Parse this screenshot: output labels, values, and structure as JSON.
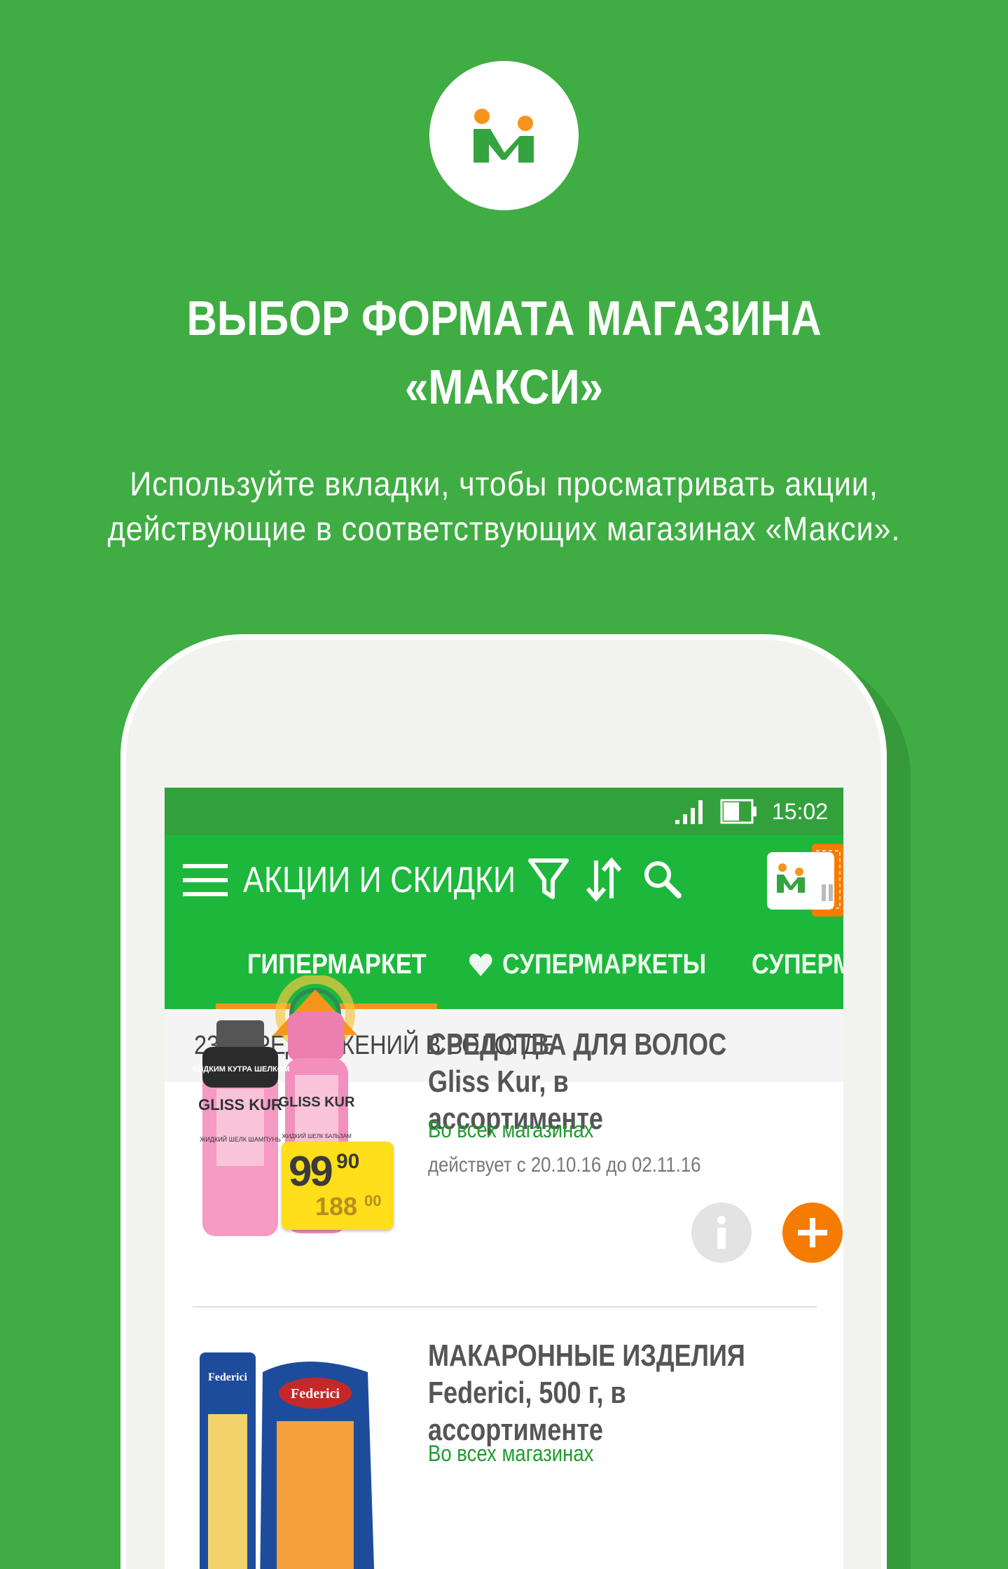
{
  "header": {
    "headline_line1": "ВЫБОР ФОРМАТА МАГАЗИНА",
    "headline_line2": "«МАКСИ»",
    "subline_line1": "Используйте вкладки, чтобы просматривать акции,",
    "subline_line2": "действующие в соответствующих магазинах «Макси»."
  },
  "statusbar": {
    "time": "15:02"
  },
  "toolbar": {
    "title": "АКЦИИ И СКИДКИ",
    "icons": [
      "menu-icon",
      "filter-icon",
      "sort-icon",
      "search-icon",
      "store-logo-icon"
    ]
  },
  "tabs": [
    {
      "label": "ГИПЕРМАРКЕТ",
      "active": true
    },
    {
      "label": "СУПЕРМАРКЕТЫ",
      "active": false,
      "icon": "heart-icon"
    },
    {
      "label": "СУПЕРМ",
      "active": false
    }
  ],
  "count_label": "230 ПРЕДЛОЖЕНИЙ В ВОЛОГДЕ",
  "products": [
    {
      "title": "СРЕДСТВА ДЛЯ ВОЛОС Gliss Kur, в ассортименте",
      "availability": "Во всех магазинах",
      "dates": "действует с 20.10.16 до 02.11.16",
      "price_new": "99",
      "price_new_cents": "90",
      "price_old": "188",
      "price_old_cents": "00",
      "image_text": [
        "ЖИДКИМ КУТРА ШЕЛКОМ",
        "GLISS KUR",
        "ЖИДКИЙ ШЕЛК ШАМПУНЬ",
        "GLISS KUR",
        "ЖИДКИЙ ШЕЛК БАЛЬЗАМ"
      ]
    },
    {
      "title": "МАКАРОННЫЕ ИЗДЕЛИЯ Federici, 500 г, в ассортименте",
      "availability": "Во всех магазинах",
      "image_text": [
        "Federici",
        "Federici"
      ]
    }
  ],
  "colors": {
    "background": "#3fad43",
    "toolbar": "#1db83b",
    "statusbar": "#33a13b",
    "accent_orange": "#f57c00",
    "price_tag": "#ffde1a"
  }
}
